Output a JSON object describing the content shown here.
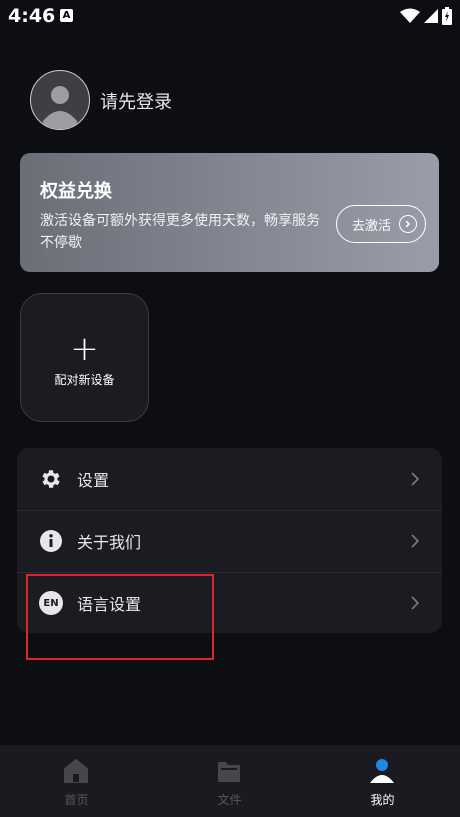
{
  "status_bar": {
    "time": "4:46",
    "a_glyph": "A"
  },
  "profile": {
    "login_prompt": "请先登录"
  },
  "benefit_card": {
    "title": "权益兑换",
    "description": "激活设备可额外获得更多使用天数，畅享服务不停歇",
    "activate_label": "去激活"
  },
  "device": {
    "plus": "+",
    "add_label": "配对新设备"
  },
  "menu": {
    "items": [
      {
        "label": "设置",
        "icon": "gear-icon"
      },
      {
        "label": "关于我们",
        "icon": "info-icon"
      },
      {
        "label": "语言设置",
        "icon": "en-icon",
        "icon_text": "EN"
      }
    ]
  },
  "tabbar": {
    "tabs": [
      {
        "label": "首页",
        "icon": "home-icon",
        "active": false
      },
      {
        "label": "文件",
        "icon": "folder-icon",
        "active": false
      },
      {
        "label": "我的",
        "icon": "profile-icon",
        "active": true
      }
    ]
  },
  "colors": {
    "background": "#0d0e12",
    "card_gradient_start": "#6b6d77",
    "card_gradient_end": "#9a9ca8",
    "accent_blue": "#1e88e5",
    "highlight_red": "#e8202a"
  }
}
